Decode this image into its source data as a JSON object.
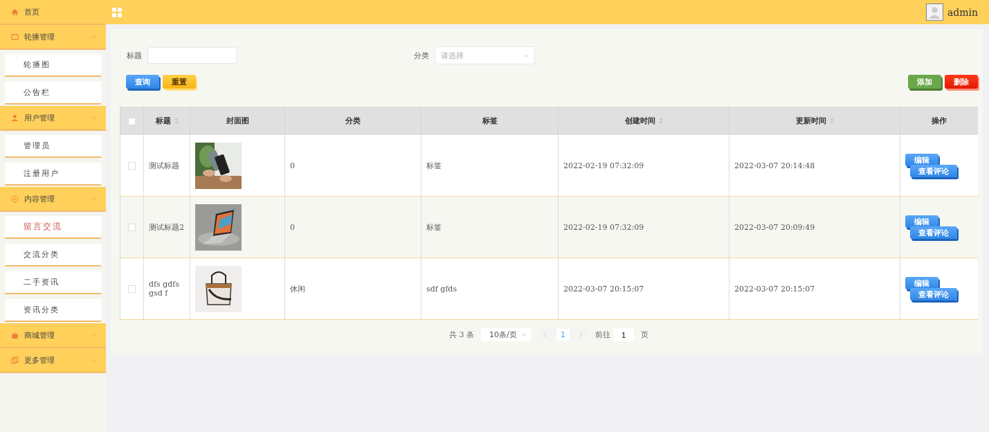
{
  "sidebar": {
    "items": [
      {
        "label": "首页",
        "kind": "link"
      },
      {
        "label": "轮播管理",
        "kind": "group",
        "expanded": true,
        "children": [
          {
            "label": "轮播图",
            "selected": false
          },
          {
            "label": "公告栏",
            "selected": false
          }
        ]
      },
      {
        "label": "用户管理",
        "kind": "group",
        "expanded": true,
        "children": [
          {
            "label": "管理员",
            "selected": false
          },
          {
            "label": "注册用户",
            "selected": false
          }
        ]
      },
      {
        "label": "内容管理",
        "kind": "group",
        "expanded": true,
        "children": [
          {
            "label": "留言交流",
            "selected": true
          },
          {
            "label": "交流分类",
            "selected": false
          },
          {
            "label": "二手资讯",
            "selected": false
          },
          {
            "label": "资讯分类",
            "selected": false
          }
        ]
      },
      {
        "label": "商城管理",
        "kind": "group",
        "expanded": false
      },
      {
        "label": "更多管理",
        "kind": "group",
        "expanded": false
      }
    ]
  },
  "header": {
    "user": "admin"
  },
  "search": {
    "fields": [
      {
        "label": "标题",
        "kind": "text"
      },
      {
        "label": "分类",
        "kind": "select",
        "placeholder": "请选择"
      }
    ],
    "buttons": [
      {
        "label": "查询",
        "kind": "query"
      },
      {
        "label": "重置",
        "kind": "reset"
      }
    ]
  },
  "actions": [
    {
      "label": "添加",
      "kind": "add"
    },
    {
      "label": "删除",
      "kind": "delete"
    }
  ],
  "table": {
    "columns": [
      {
        "label": "标题",
        "sortable": true
      },
      {
        "label": "封面图",
        "sortable": false
      },
      {
        "label": "分类",
        "sortable": false
      },
      {
        "label": "标签",
        "sortable": false
      },
      {
        "label": "创建时间",
        "sortable": true
      },
      {
        "label": "更新时间",
        "sortable": true
      },
      {
        "label": "操作",
        "sortable": false
      }
    ],
    "all_checked": false,
    "rows": [
      {
        "checked": false,
        "title": "测试标题",
        "cover": {
          "kind": "picture"
        },
        "category": "0",
        "tag": "标签",
        "created": "2022-02-19 07:32:09",
        "updated": "2022-03-07 20:14:48",
        "buttons": [
          "编辑",
          "查看评论"
        ]
      },
      {
        "checked": false,
        "title": "测试标题2",
        "cover": {
          "kind": "picture"
        },
        "category": "0",
        "tag": "标签",
        "created": "2022-02-19 07:32:09",
        "updated": "2022-03-07 20:09:49",
        "buttons": [
          "编辑",
          "查看评论"
        ]
      },
      {
        "checked": false,
        "title": "dfs gdfs gsd f",
        "cover": {
          "kind": "picture"
        },
        "category": "休闲",
        "tag": "sdf gfds",
        "created": "2022-03-07 20:15:07",
        "updated": "2022-03-07 20:15:07",
        "buttons": [
          "编辑",
          "查看评论"
        ]
      }
    ]
  },
  "pagination": {
    "total": "共 3 条",
    "page_size": "10条/页",
    "pages": [
      {
        "label": "1",
        "selected": true
      }
    ],
    "goto_label": "前往",
    "goto_value": "1",
    "goto_suffix": "页"
  }
}
